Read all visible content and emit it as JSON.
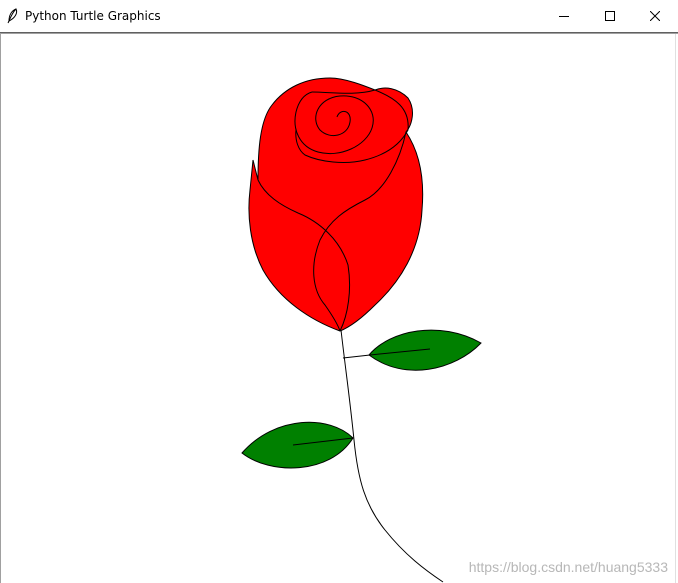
{
  "window": {
    "title": "Python Turtle Graphics",
    "icon": "feather-icon",
    "controls": {
      "minimize": "minimize-icon",
      "maximize": "maximize-icon",
      "close": "close-icon"
    }
  },
  "canvas": {
    "background": "#ffffff",
    "colors": {
      "petal": "#ff0000",
      "leaf": "#008000",
      "outline": "#000000"
    },
    "watermark": "https://blog.csdn.net/huang5333"
  }
}
